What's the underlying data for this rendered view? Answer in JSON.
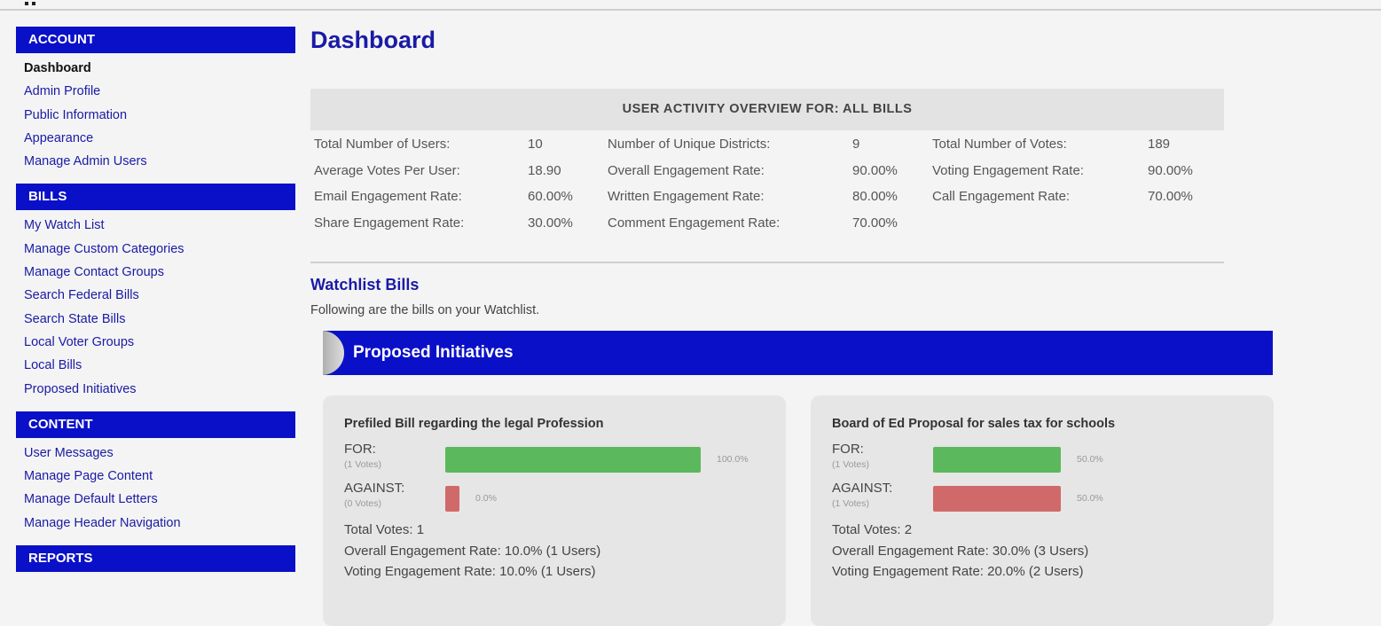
{
  "sidebar": {
    "sections": [
      {
        "title": "ACCOUNT",
        "items": [
          "Dashboard",
          "Admin Profile",
          "Public Information",
          "Appearance",
          "Manage Admin Users"
        ]
      },
      {
        "title": "BILLS",
        "items": [
          "My Watch List",
          "Manage Custom Categories",
          "Manage Contact Groups",
          "Search Federal Bills",
          "Search State Bills",
          "Local Voter Groups",
          "Local Bills",
          "Proposed Initiatives"
        ]
      },
      {
        "title": "CONTENT",
        "items": [
          "User Messages",
          "Manage Page Content",
          "Manage Default Letters",
          "Manage Header Navigation"
        ]
      },
      {
        "title": "REPORTS",
        "items": []
      }
    ],
    "active_item": "Dashboard"
  },
  "main": {
    "title": "Dashboard",
    "overview_title": "USER ACTIVITY OVERVIEW FOR:   ALL BILLS",
    "stats": [
      [
        {
          "label": "Total Number of Users:",
          "value": "10"
        },
        {
          "label": "Number of Unique Districts:",
          "value": "9"
        },
        {
          "label": "Total Number of Votes:",
          "value": "189"
        }
      ],
      [
        {
          "label": "Average Votes Per User:",
          "value": "18.90"
        },
        {
          "label": "Overall Engagement Rate:",
          "value": "90.00%"
        },
        {
          "label": "Voting Engagement Rate:",
          "value": "90.00%"
        }
      ],
      [
        {
          "label": "Email Engagement Rate:",
          "value": "60.00%"
        },
        {
          "label": "Written Engagement Rate:",
          "value": "80.00%"
        },
        {
          "label": "Call Engagement Rate:",
          "value": "70.00%"
        }
      ],
      [
        {
          "label": "Share Engagement Rate:",
          "value": "30.00%"
        },
        {
          "label": "Comment Engagement Rate:",
          "value": "70.00%"
        }
      ]
    ],
    "watchlist_title": "Watchlist Bills",
    "watchlist_subtitle": "Following are the bills on your Watchlist.",
    "banner": "Proposed Initiatives",
    "cards": [
      {
        "title": "Prefiled Bill regarding the legal Profession",
        "for_label": "FOR:",
        "for_votes": "(1 Votes)",
        "for_pct": "100.0%",
        "for_fraction": 1.0,
        "against_label": "AGAINST:",
        "against_votes": "(0 Votes)",
        "against_pct": "0.0%",
        "against_fraction": 0.0,
        "total": "Total Votes: 1",
        "overall": "Overall Engagement Rate: 10.0% (1 Users)",
        "voting": "Voting Engagement Rate: 10.0% (1 Users)"
      },
      {
        "title": "Board of Ed Proposal for sales tax for schools",
        "for_label": "FOR:",
        "for_votes": "(1 Votes)",
        "for_pct": "50.0%",
        "for_fraction": 0.5,
        "against_label": "AGAINST:",
        "against_votes": "(1 Votes)",
        "against_pct": "50.0%",
        "against_fraction": 0.5,
        "total": "Total Votes: 2",
        "overall": "Overall Engagement Rate: 30.0% (3 Users)",
        "voting": "Voting Engagement Rate: 20.0% (2 Users)"
      }
    ]
  },
  "colors": {
    "brand_blue": "#0a10c8",
    "link_blue": "#1a1aa6",
    "for_green": "#5cb85c",
    "against_red": "#d06a6a"
  }
}
